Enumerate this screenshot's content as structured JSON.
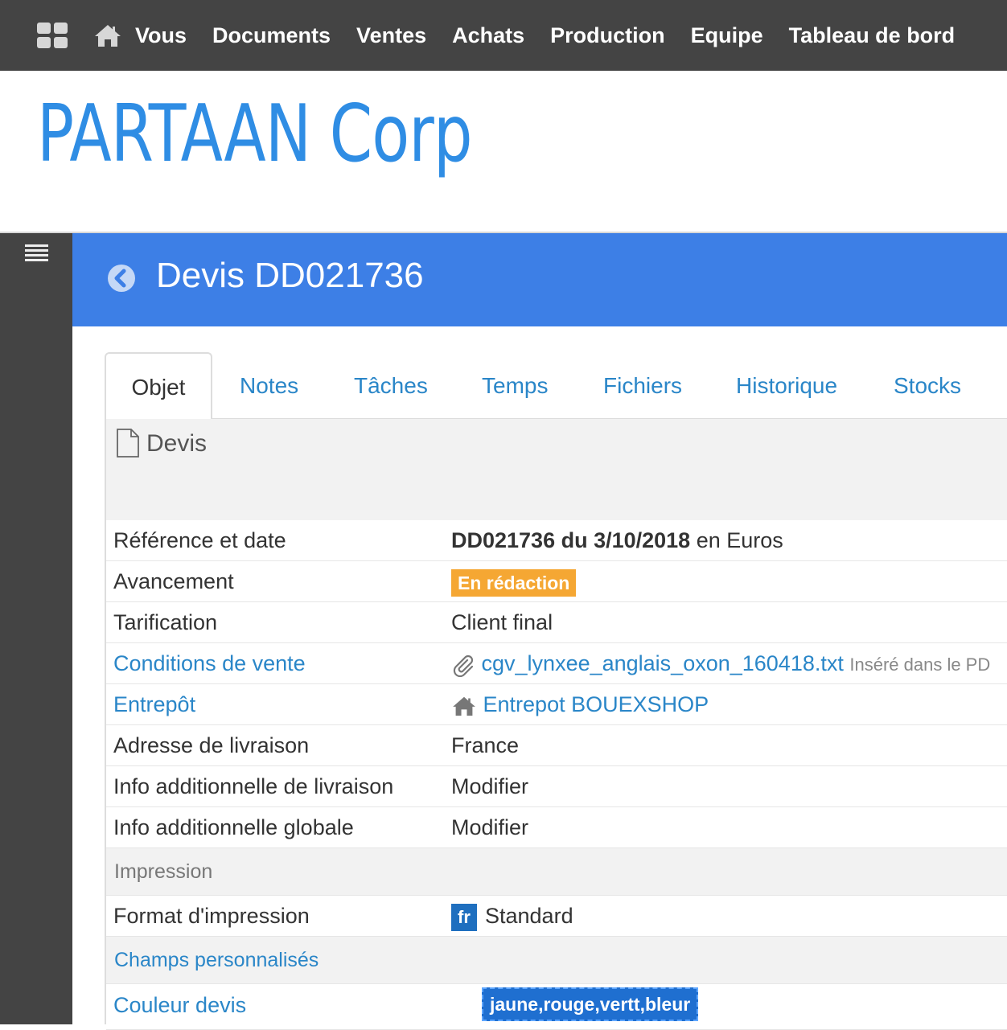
{
  "topnav": {
    "items": [
      "Vous",
      "Documents",
      "Ventes",
      "Achats",
      "Production",
      "Equipe",
      "Tableau de bord"
    ]
  },
  "logo": {
    "text": "PARTAAN Corp",
    "color": "#2f8de4"
  },
  "header": {
    "title": "Devis DD021736",
    "color": "#3d7fe6"
  },
  "tabs": [
    "Objet",
    "Notes",
    "Tâches",
    "Temps",
    "Fichiers",
    "Historique",
    "Stocks"
  ],
  "active_tab": "Objet",
  "section": {
    "title": "Devis"
  },
  "fields": {
    "reference": {
      "label": "Référence et date",
      "value_bold": "DD021736 du 3/10/2018",
      "value_suffix": " en Euros"
    },
    "avancement": {
      "label": "Avancement",
      "badge": "En rédaction",
      "badge_color": "#f5a733"
    },
    "tarification": {
      "label": "Tarification",
      "value": "Client final"
    },
    "conditions": {
      "label": "Conditions de vente",
      "file": "cgv_lynxee_anglais_oxon_160418.txt",
      "note": "Inséré dans le PD"
    },
    "entrepot": {
      "label": "Entrepôt",
      "value": "Entrepot BOUEXSHOP"
    },
    "adresse": {
      "label": "Adresse de livraison",
      "value": "France"
    },
    "info_livraison": {
      "label": "Info additionnelle de livraison",
      "action": "Modifier"
    },
    "info_globale": {
      "label": "Info additionnelle globale",
      "action": "Modifier"
    }
  },
  "impression": {
    "title": "Impression",
    "format": {
      "label": "Format d'impression",
      "lang": "fr",
      "value": "Standard"
    }
  },
  "custom": {
    "title": "Champs personnalisés",
    "couleur": {
      "label": "Couleur devis",
      "value": "jaune,rouge,vertt,bleur"
    }
  }
}
